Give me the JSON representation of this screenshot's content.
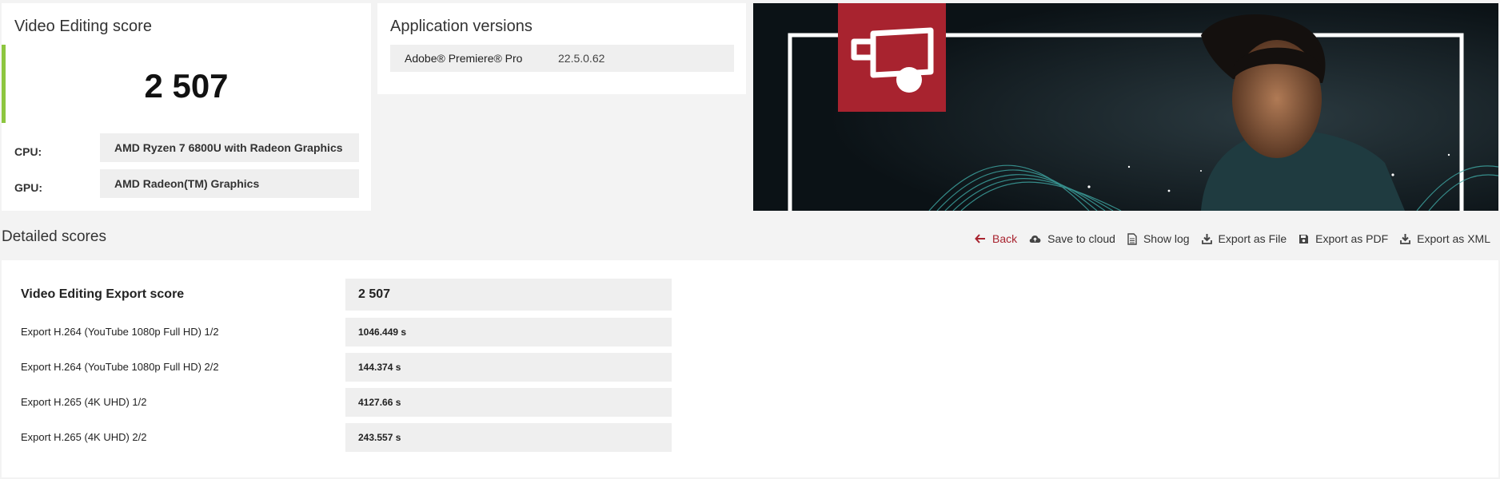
{
  "score_card": {
    "title": "Video Editing score",
    "score": "2 507",
    "cpu_label": "CPU:",
    "cpu_value": "AMD Ryzen 7 6800U with Radeon Graphics",
    "gpu_label": "GPU:",
    "gpu_value": "AMD Radeon(TM) Graphics",
    "accent_color": "#8dc63f"
  },
  "app_versions": {
    "title": "Application versions",
    "rows": [
      {
        "name": "Adobe® Premiere® Pro",
        "version": "22.5.0.62"
      }
    ]
  },
  "banner": {
    "logo_icon": "video-editing-icon",
    "logo_color": "#a8232f"
  },
  "detailed": {
    "title": "Detailed scores",
    "actions": [
      {
        "label": "Back",
        "icon": "arrow-left-icon"
      },
      {
        "label": "Save to cloud",
        "icon": "cloud-upload-icon"
      },
      {
        "label": "Show log",
        "icon": "document-icon"
      },
      {
        "label": "Export as File",
        "icon": "download-icon"
      },
      {
        "label": "Export as PDF",
        "icon": "floppy-disk-icon"
      },
      {
        "label": "Export as XML",
        "icon": "download-icon"
      }
    ],
    "rows": [
      {
        "label": "Video Editing Export score",
        "value": "2 507"
      },
      {
        "label": "Export H.264 (YouTube 1080p Full HD) 1/2",
        "value": "1046.449 s"
      },
      {
        "label": "Export H.264 (YouTube 1080p Full HD) 2/2",
        "value": "144.374 s"
      },
      {
        "label": "Export H.265 (4K UHD) 1/2",
        "value": "4127.66 s"
      },
      {
        "label": "Export H.265 (4K UHD) 2/2",
        "value": "243.557 s"
      }
    ]
  }
}
